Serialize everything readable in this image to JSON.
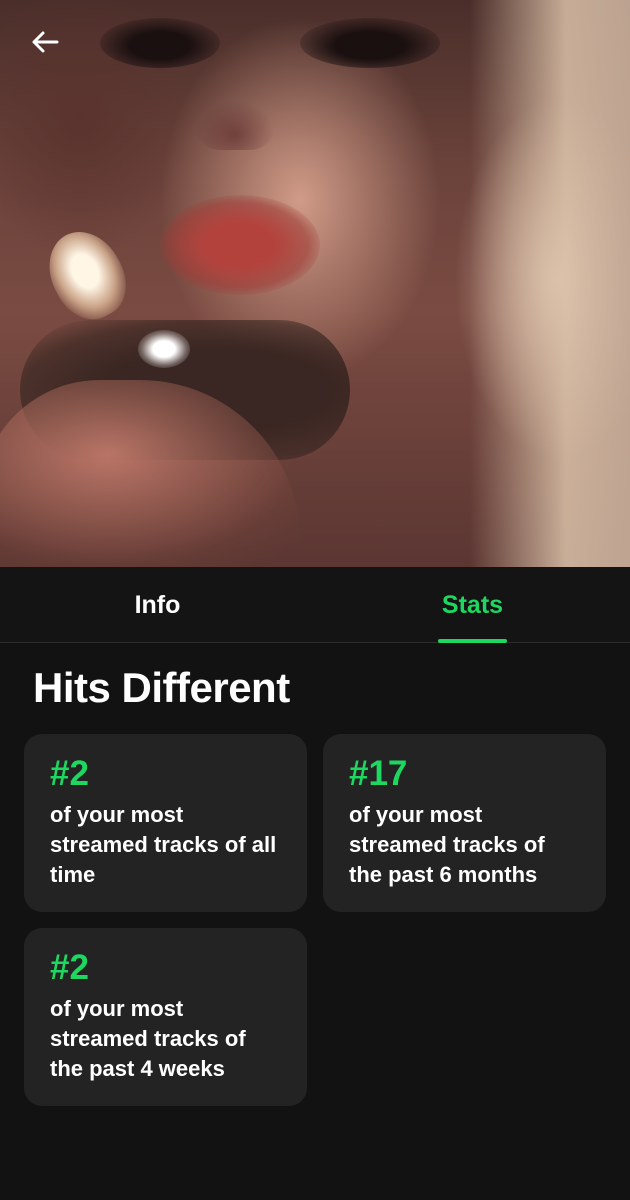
{
  "header": {
    "back_icon": "arrow-left-icon"
  },
  "tabs": [
    {
      "label": "Info",
      "active": false
    },
    {
      "label": "Stats",
      "active": true
    }
  ],
  "colors": {
    "accent": "#1ed760",
    "background": "#121212",
    "card": "#232323",
    "text": "#ffffff"
  },
  "song": {
    "title": "Hits Different"
  },
  "stats": [
    {
      "rank": "#2",
      "description": "of your most streamed tracks of all time"
    },
    {
      "rank": "#17",
      "description": "of your most streamed tracks of the past 6 months"
    },
    {
      "rank": "#2",
      "description": "of your most streamed tracks of the past 4 weeks"
    }
  ]
}
